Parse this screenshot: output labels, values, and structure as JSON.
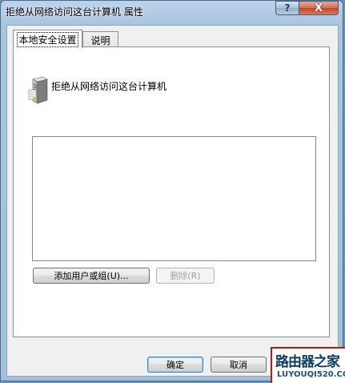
{
  "window": {
    "title": "拒绝从网络访问这台计算机 属性",
    "help_label": "?",
    "close_label": "X"
  },
  "tabs": [
    {
      "label": "本地安全设置",
      "active": true
    },
    {
      "label": "说明",
      "active": false
    }
  ],
  "policy": {
    "icon": "server-icon",
    "name": "拒绝从网络访问这台计算机"
  },
  "list": {
    "items": []
  },
  "buttons": {
    "add_user": "添加用户或组(U)...",
    "remove": "删除(R)",
    "ok": "确定",
    "cancel": "取消"
  },
  "watermark": {
    "title": "路由器之家",
    "url": "LUYOUQI520.COM"
  }
}
